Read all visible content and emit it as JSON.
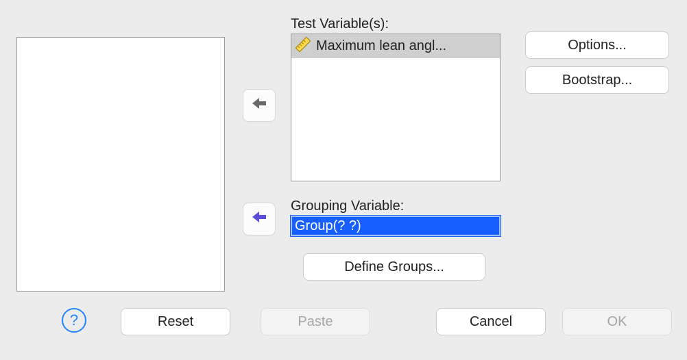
{
  "labels": {
    "test_variables": "Test Variable(s):",
    "grouping_variable": "Grouping Variable:"
  },
  "source_list": {
    "items": []
  },
  "test_variables": {
    "items": [
      {
        "icon": "ruler-icon",
        "label": "Maximum lean angl..."
      }
    ]
  },
  "grouping_variable": {
    "value": "Group(? ?)"
  },
  "buttons": {
    "options": "Options...",
    "bootstrap": "Bootstrap...",
    "define_groups": "Define Groups...",
    "reset": "Reset",
    "paste": "Paste",
    "cancel": "Cancel",
    "ok": "OK",
    "help": "?"
  },
  "icons": {
    "arrow_tv_direction": "left",
    "arrow_gv_direction": "left"
  },
  "colors": {
    "selection_bg": "#175fff",
    "selection_border": "#9fc2ff",
    "item_selected_bg": "#cfcfcf",
    "window_bg": "#ececec",
    "gv_arrow": "#5a4dd8",
    "tv_arrow": "#6a6a6a"
  }
}
